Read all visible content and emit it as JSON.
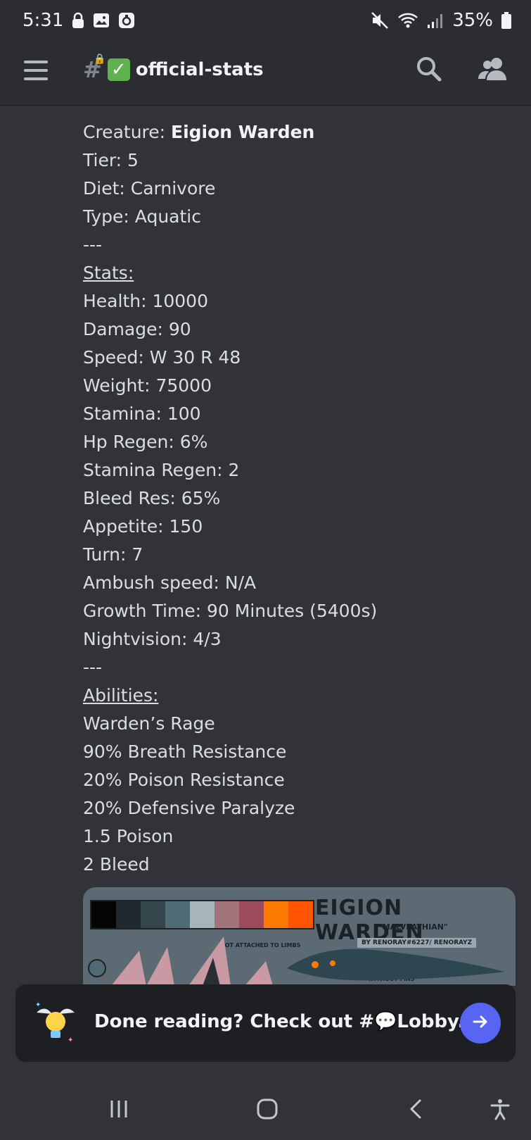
{
  "status_bar": {
    "time": "5:31",
    "battery": "35%",
    "icons_left": [
      "lock-icon",
      "image-icon",
      "instagram-icon"
    ],
    "icons_right": [
      "mute-icon",
      "wifi-icon",
      "signal-icon",
      "battery-icon"
    ]
  },
  "header": {
    "channel_name": "official-stats",
    "channel_emoji": "✅"
  },
  "message": {
    "creature_label": "Creature: ",
    "creature_name": "Eigion Warden",
    "tier": "Tier: 5",
    "diet": "Diet: Carnivore",
    "type": "Type: Aquatic",
    "sep1": "---",
    "stats_heading": "Stats:",
    "stats": [
      "Health: 10000",
      "Damage: 90",
      "Speed: W 30 R 48",
      "Weight: 75000",
      "Stamina: 100",
      "Hp Regen: 6%",
      "Stamina Regen: 2",
      "Bleed Res: 65%",
      "Appetite: 150",
      "Turn: 7",
      "Ambush speed: N/A",
      "Growth Time: 90 Minutes (5400s)",
      "Nightvision: 4/3"
    ],
    "sep2": "---",
    "abilities_heading": "Abilities:",
    "abilities": [
      "Warden’s Rage",
      "90% Breath Resistance",
      "20% Poison Resistance",
      "20% Defensive Paralyze",
      "1.5 Poison",
      "2 Bleed"
    ]
  },
  "embed": {
    "title": "EIGION WARDEN",
    "subtitle": "\"MALVEATHIAN\"",
    "byline": "BY RENORAY#6227/ RENORAYZ",
    "note_limbs": "NOT ATTACHED TO LIMBS",
    "note_fins": "WITHOUT FINS",
    "palette": [
      "#050505",
      "#1f2a30",
      "#33474d",
      "#4f6b73",
      "#a7b5ba",
      "#a2737b",
      "#9b4b5a",
      "#ff7a00",
      "#ff5500"
    ]
  },
  "toast": {
    "text": "Done reading? Check out #💬Lobby.",
    "button_icon": "arrow-right-icon"
  },
  "navbar": {
    "buttons": [
      "recent-apps-icon",
      "home-icon",
      "back-icon",
      "accessibility-icon"
    ]
  }
}
